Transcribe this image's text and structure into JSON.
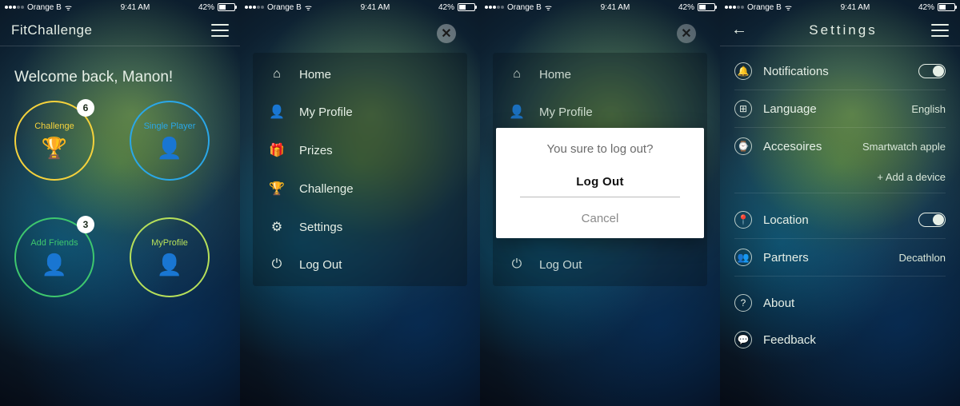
{
  "status": {
    "carrier": "Orange B",
    "time": "9:41 AM",
    "battery_pct": "42%"
  },
  "screen1": {
    "app_title": "FitChallenge",
    "welcome": "Welcome back, Manon!",
    "circles": {
      "challenge": {
        "label": "Challenge",
        "badge": "6"
      },
      "single": {
        "label": "Single Player"
      },
      "add_friends": {
        "label": "Add Friends",
        "badge": "3"
      },
      "my_profile": {
        "label": "MyProfile"
      }
    }
  },
  "menu": {
    "home": "Home",
    "profile": "My Profile",
    "prizes": "Prizes",
    "challenge": "Challenge",
    "settings": "Settings",
    "logout": "Log Out"
  },
  "logout_modal": {
    "question": "You sure to log out?",
    "confirm": "Log Out",
    "cancel": "Cancel"
  },
  "settings": {
    "title": "Settings",
    "notifications": {
      "label": "Notifications",
      "on": true
    },
    "language": {
      "label": "Language",
      "value": "English"
    },
    "accessories": {
      "label": "Accesoires",
      "value": "Smartwatch apple",
      "add": "+ Add a device"
    },
    "location": {
      "label": "Location",
      "on": true
    },
    "partners": {
      "label": "Partners",
      "value": "Decathlon"
    },
    "about": {
      "label": "About"
    },
    "feedback": {
      "label": "Feedback"
    }
  }
}
